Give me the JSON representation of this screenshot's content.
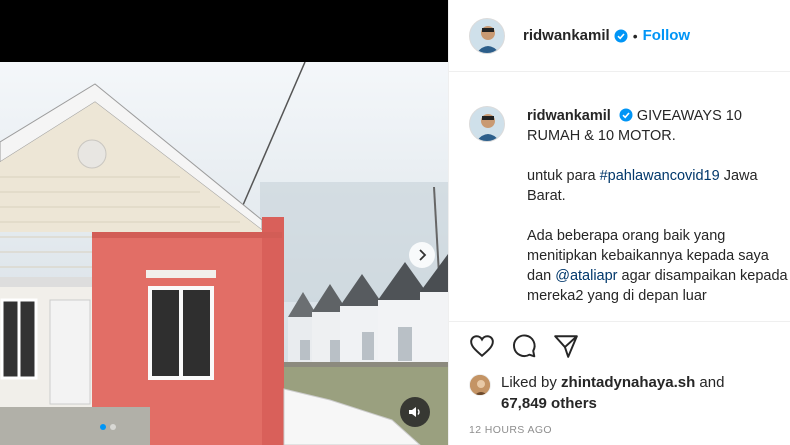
{
  "post": {
    "username": "ridwankamil",
    "follow_label": "Follow",
    "separator": "•",
    "caption_lines": [
      "GIVEAWAYS 10 RUMAH & 10 MOTOR.",
      "untuk para ",
      "Jawa Barat.",
      "Ada beberapa orang baik yang menitipkan kebaikannya kepada saya dan ",
      "agar disampaikan kepada mereka2 yang di depan luar"
    ],
    "hashtag": "#pahlawancovid19",
    "mention": "@ataliapr",
    "liked_by_prefix": "Liked by",
    "liked_by_user": "zhintadynahaya.sh",
    "liked_by_and": "and",
    "others_count": "67,849 others",
    "time_ago": "12 HOURS AGO"
  },
  "media": {
    "carousel_dots": 2,
    "active_dot": 0
  },
  "icons": {
    "verified": "verified-badge-icon",
    "like": "heart-icon",
    "comment": "comment-icon",
    "share": "paper-plane-icon",
    "next": "chevron-right-icon",
    "audio": "speaker-icon"
  },
  "colors": {
    "accent": "#0095f6",
    "text": "#262626",
    "muted": "#8e8e8e",
    "link": "#00376b"
  }
}
